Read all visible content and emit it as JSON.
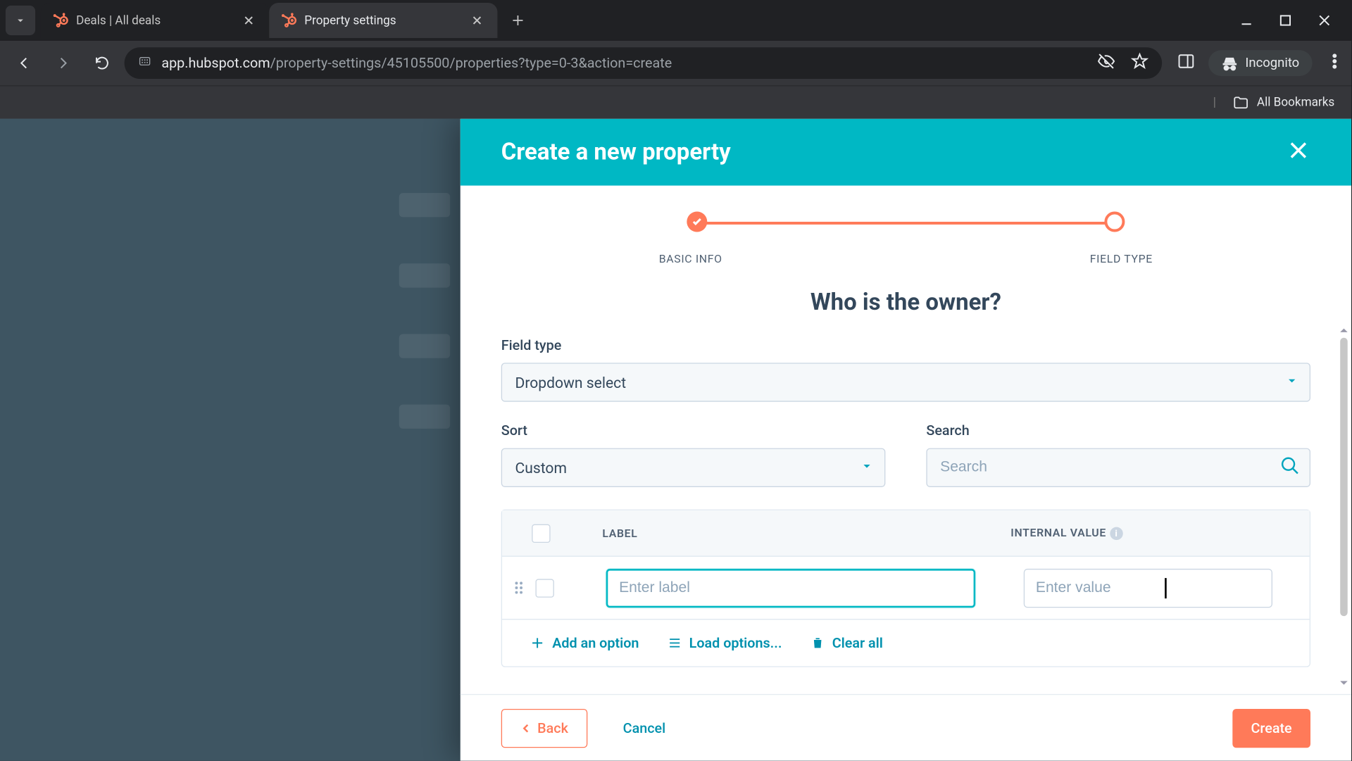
{
  "browser": {
    "tabs": [
      {
        "title": "Deals | All deals",
        "active": false
      },
      {
        "title": "Property settings",
        "active": true
      }
    ],
    "url_host": "app.hubspot.com",
    "url_path": "/property-settings/45105500/properties?type=0-3&action=create",
    "incognito_label": "Incognito",
    "all_bookmarks": "All Bookmarks"
  },
  "panel": {
    "title": "Create a new property",
    "steps": {
      "basic_info": "BASIC INFO",
      "field_type": "FIELD TYPE"
    },
    "question": "Who is the owner?",
    "field_type_label": "Field type",
    "field_type_value": "Dropdown select",
    "sort_label": "Sort",
    "sort_value": "Custom",
    "search_label": "Search",
    "search_placeholder": "Search",
    "table": {
      "col_label": "LABEL",
      "col_internal": "INTERNAL VALUE",
      "label_placeholder": "Enter label",
      "value_placeholder": "Enter value"
    },
    "actions": {
      "add_option": "Add an option",
      "load_options": "Load options...",
      "clear_all": "Clear all"
    },
    "footer": {
      "back": "Back",
      "cancel": "Cancel",
      "create": "Create"
    }
  }
}
